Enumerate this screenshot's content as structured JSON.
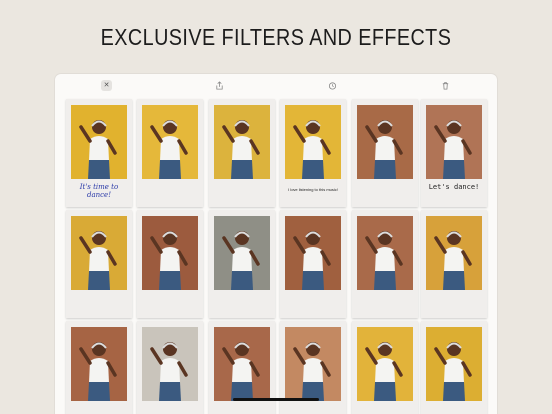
{
  "headline": "EXCLUSIVE FILTERS AND EFFECTS",
  "toolbar": {
    "close": {
      "icon": "close-icon"
    },
    "share": {
      "icon": "share-icon"
    },
    "timer": {
      "icon": "timer-icon"
    },
    "trash": {
      "icon": "trash-icon"
    }
  },
  "cards": [
    {
      "bg": "#e1b22e",
      "caption": "It's time to dance!",
      "style": "blue"
    },
    {
      "bg": "#e5b83a",
      "caption": "",
      "style": ""
    },
    {
      "bg": "#dcb33d",
      "caption": "",
      "style": ""
    },
    {
      "bg": "#e3b637",
      "caption": "I love listening to this music!",
      "style": "tiny"
    },
    {
      "bg": "#a86a47",
      "caption": "",
      "style": ""
    },
    {
      "bg": "#b07456",
      "caption": "Let's dance!",
      "style": "mono"
    },
    {
      "bg": "#d9aa36",
      "caption": "",
      "style": ""
    },
    {
      "bg": "#9c5b3e",
      "caption": "",
      "style": ""
    },
    {
      "bg": "#8f8f86",
      "caption": "",
      "style": ""
    },
    {
      "bg": "#a0603f",
      "caption": "",
      "style": ""
    },
    {
      "bg": "#a96a4a",
      "caption": "",
      "style": ""
    },
    {
      "bg": "#d7a13a",
      "caption": "",
      "style": ""
    },
    {
      "bg": "#a66444",
      "caption": "",
      "style": ""
    },
    {
      "bg": "#c9c4bb",
      "caption": "",
      "style": ""
    },
    {
      "bg": "#a8684a",
      "caption": "",
      "style": ""
    },
    {
      "bg": "#c38962",
      "caption": "",
      "style": ""
    },
    {
      "bg": "#e2b33a",
      "caption": "",
      "style": ""
    },
    {
      "bg": "#dcae32",
      "caption": "",
      "style": ""
    }
  ]
}
